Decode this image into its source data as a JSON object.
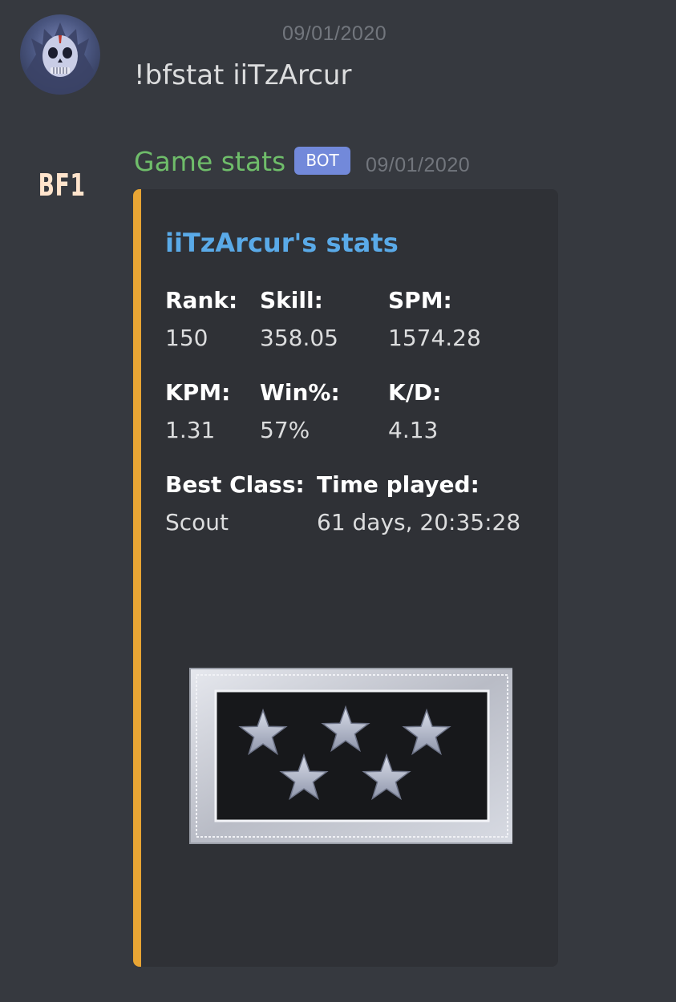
{
  "message_user": {
    "timestamp": "09/01/2020",
    "content": "!bfstat iiTzArcur"
  },
  "message_bot": {
    "author": "Game stats",
    "badge": "BOT",
    "timestamp": "09/01/2020",
    "avatar_text": "BF1",
    "accent_color": "#e8a534",
    "embed": {
      "title": "iiTzArcur's stats",
      "fields": [
        {
          "name": "Rank:",
          "value": "150"
        },
        {
          "name": "Skill:",
          "value": "358.05"
        },
        {
          "name": "SPM:",
          "value": "1574.28"
        },
        {
          "name": "KPM:",
          "value": "1.31"
        },
        {
          "name": "Win%:",
          "value": "57%"
        },
        {
          "name": "K/D:",
          "value": "4.13"
        },
        {
          "name": "Best Class:",
          "value": "Scout"
        },
        {
          "name": "Time played:",
          "value": "61 days, 20:35:28"
        }
      ],
      "image_icon": "rank-insignia-five-stars-icon"
    }
  }
}
